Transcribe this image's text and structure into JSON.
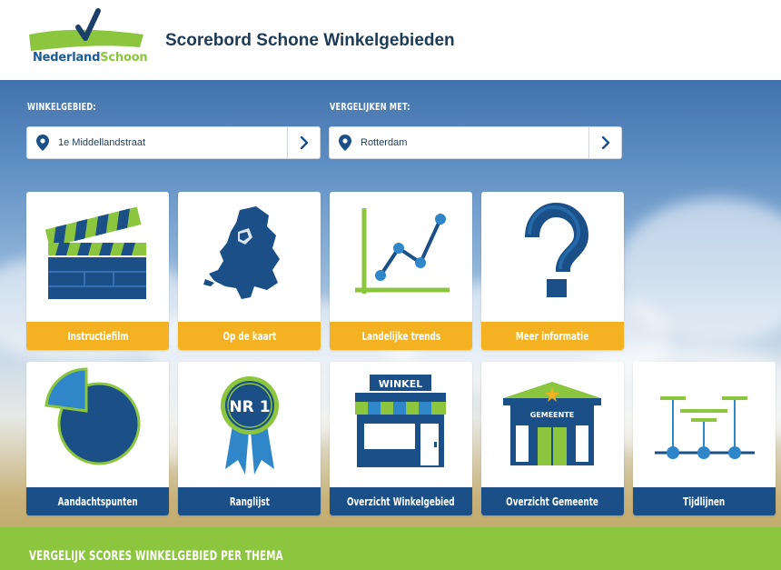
{
  "header": {
    "logo_text_main": "Nederland",
    "logo_text_accent": "Schoon",
    "title": "Scorebord Schone Winkelgebieden"
  },
  "selectors": {
    "area_label": "WINKELGEBIED:",
    "area_value": "1e Middellandstraat",
    "compare_label": "VERGELIJKEN MET:",
    "compare_value": "Rotterdam"
  },
  "tiles_row1": [
    {
      "label": "Instructiefilm",
      "icon": "clapperboard-icon"
    },
    {
      "label": "Op de kaart",
      "icon": "netherlands-map-icon"
    },
    {
      "label": "Landelijke trends",
      "icon": "line-chart-icon"
    },
    {
      "label": "Meer informatie",
      "icon": "question-mark-icon"
    }
  ],
  "tiles_row2": [
    {
      "label": "Aandachtspunten",
      "icon": "pie-chart-icon"
    },
    {
      "label": "Ranglijst",
      "icon": "rosette-icon",
      "badge_text": "NR 1"
    },
    {
      "label": "Overzicht Winkelgebied",
      "icon": "shop-icon",
      "sign_text": "WINKEL"
    },
    {
      "label": "Overzicht Gemeente",
      "icon": "town-hall-icon",
      "sign_text": "GEMEENTE"
    },
    {
      "label": "Tijdlijnen",
      "icon": "timeline-icon"
    }
  ],
  "banner": {
    "text": "VERGELIJK SCORES WINKELGEBIED PER THEMA"
  },
  "colors": {
    "navy": "#1a4f87",
    "orange": "#f4b223",
    "green": "#8cc63f"
  }
}
